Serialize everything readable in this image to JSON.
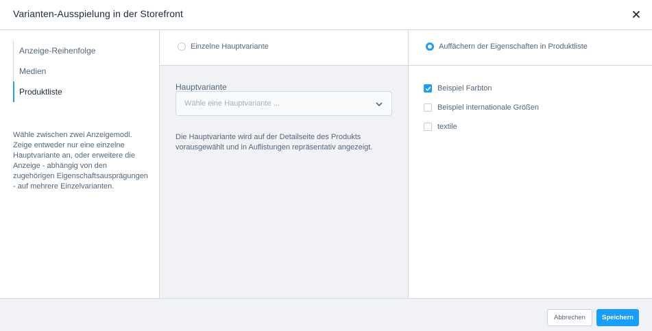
{
  "modal": {
    "title": "Varianten-Ausspielung in der Storefront",
    "close_icon": "close-icon"
  },
  "sidebar": {
    "items": [
      {
        "label": "Anzeige-Reihenfolge",
        "active": false
      },
      {
        "label": "Medien",
        "active": false
      },
      {
        "label": "Produktliste",
        "active": true
      }
    ],
    "help_text": "Wähle zwischen zwei Anzeigemodi. Zeige entweder nur eine einzelne Hauptvariante an, oder erweitere die Anzeige - abhängig von den zugehörigen Eigenschaftsausprägungen - auf mehrere Einzelvarianten."
  },
  "main_variant_mode": {
    "label": "Einzelne Hauptvariante",
    "selected": false,
    "field_label": "Hauptvariante",
    "select_placeholder": "Wähle eine Hauptvariante ...",
    "help_text": "Die Hauptvariante wird auf der Detailseite des Produkts vorausgewählt und in Auflistungen repräsentativ angezeigt."
  },
  "expand_mode": {
    "label": "Auffächern der Eigenschaften in Produktliste",
    "selected": true,
    "properties": [
      {
        "label": "Beispiel Farbton",
        "checked": true
      },
      {
        "label": "Beispiel internationale Größen",
        "checked": false
      },
      {
        "label": "textile",
        "checked": false
      }
    ]
  },
  "footer": {
    "cancel_label": "Abbrechen",
    "save_label": "Speichern"
  },
  "colors": {
    "accent": "#189eff",
    "text": "#52667a",
    "title": "#1a2a3a",
    "border": "#d1d9e0",
    "panel_bg": "#f0f2f5"
  }
}
